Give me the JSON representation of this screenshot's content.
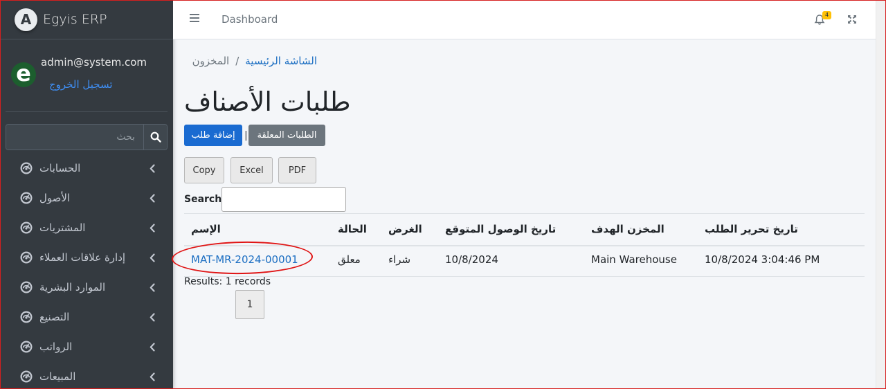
{
  "app": {
    "brand_name": "Egyis ERP",
    "brand_letter": "A"
  },
  "user": {
    "email": "admin@system.com",
    "logout_label": "تسجيل الخروج",
    "avatar_letter": "e"
  },
  "sidebar": {
    "search_placeholder": "بحث",
    "items": [
      {
        "label": "الحسابات",
        "icon": "tachometer-icon"
      },
      {
        "label": "الأصول",
        "icon": "tachometer-icon"
      },
      {
        "label": "المشتريات",
        "icon": "tachometer-icon"
      },
      {
        "label": "إدارة علاقات العملاء",
        "icon": "tachometer-icon"
      },
      {
        "label": "الموارد البشرية",
        "icon": "tachometer-icon"
      },
      {
        "label": "التصنيع",
        "icon": "tachometer-icon"
      },
      {
        "label": "الرواتب",
        "icon": "tachometer-icon"
      },
      {
        "label": "المبيعات",
        "icon": "tachometer-icon"
      }
    ]
  },
  "topbar": {
    "dashboard_link": "Dashboard",
    "notification_count": "4"
  },
  "breadcrumb": {
    "home": "الشاشة الرئيسية",
    "separator": "/",
    "current": "المخزون"
  },
  "page": {
    "title": "طلبات الأصناف",
    "add_button": "إضافة طلب",
    "pending_button": "الطلبات المعلقة",
    "divider": "|"
  },
  "datatable": {
    "buttons": {
      "copy": "Copy",
      "excel": "Excel",
      "pdf": "PDF"
    },
    "search_label": "Search:",
    "columns": {
      "name": "الإسم",
      "status": "الحالة",
      "purpose": "الغرض",
      "expected_arrival": "تاريخ الوصول المتوقع",
      "target_warehouse": "المخزن الهدف",
      "request_date": "تاريخ تحرير الطلب"
    },
    "rows": [
      {
        "name": "MAT-MR-2024-00001",
        "status": "معلق",
        "purpose": "شراء",
        "expected_arrival": "10/8/2024",
        "target_warehouse": "Main Warehouse",
        "request_date": "10/8/2024 3:04:46 PM"
      }
    ],
    "results_text": "Results: 1 records",
    "current_page": "1"
  },
  "colors": {
    "sidebar_bg": "#343a40",
    "primary": "#1a6bd1",
    "secondary": "#6c757d",
    "link": "#1b6ec2",
    "badge": "#ffc107",
    "annotation": "#e01414"
  }
}
